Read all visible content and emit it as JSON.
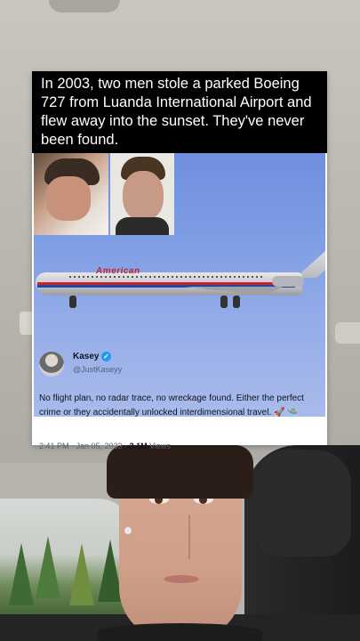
{
  "post": {
    "headline": "In 2003, two men stole a parked Boeing 727 from Luanda International Airport and flew away into the sunset. They've never been found.",
    "plane_livery": "American"
  },
  "tweet": {
    "name": "Kasey",
    "verified_mark": "✓",
    "handle": "@JustKaseyy",
    "text": "No flight plan, no radar trace, no wreckage found. Either the perfect crime or they accidentally unlocked interdimensional travel. 🚀 🛸",
    "time": "2:41 PM · Jan 05, 2023 · ",
    "views_count": "3.1M",
    "views_label": " Views"
  },
  "colors": {
    "headline_bg": "#000000",
    "verified": "#1d9bf0",
    "livery_red": "#c4262e",
    "livery_blue": "#2446a0"
  }
}
